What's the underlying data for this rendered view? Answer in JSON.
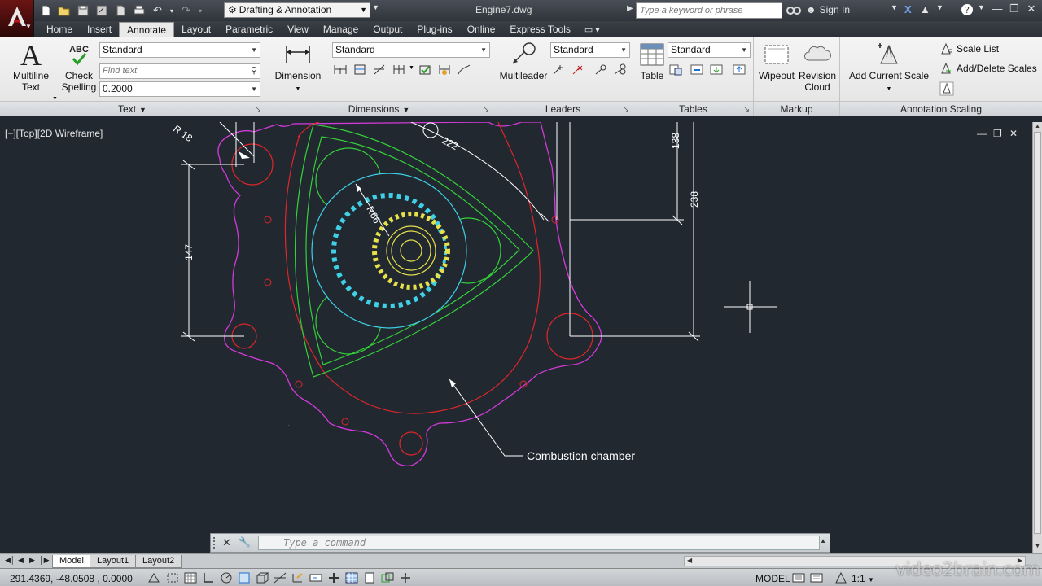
{
  "titlebar": {
    "workspace": "Drafting & Annotation",
    "document": "Engine7.dwg",
    "search_placeholder": "Type a keyword or phrase",
    "sign_in": "Sign In"
  },
  "tabs": [
    "Home",
    "Insert",
    "Annotate",
    "Layout",
    "Parametric",
    "View",
    "Manage",
    "Output",
    "Plug-ins",
    "Online",
    "Express Tools"
  ],
  "active_tab": "Annotate",
  "ribbon": {
    "text_panel": {
      "title": "Text",
      "multiline_line1": "Multiline",
      "multiline_line2": "Text",
      "check_line1": "Check",
      "check_line2": "Spelling",
      "style": "Standard",
      "find_placeholder": "Find text",
      "height": "0.2000"
    },
    "dimensions_panel": {
      "title": "Dimensions",
      "dimension_label": "Dimension",
      "style": "Standard"
    },
    "leaders_panel": {
      "title": "Leaders",
      "multileader_label": "Multileader",
      "style": "Standard"
    },
    "tables_panel": {
      "title": "Tables",
      "table_label": "Table",
      "style": "Standard"
    },
    "markup_panel": {
      "title": "Markup",
      "wipeout_label": "Wipeout",
      "revision_line1": "Revision",
      "revision_line2": "Cloud"
    },
    "annotation_scaling_panel": {
      "title": "Annotation Scaling",
      "add_current_scale": "Add Current Scale",
      "scale_list": "Scale List",
      "add_delete_scales": "Add/Delete Scales"
    }
  },
  "viewport": {
    "label": "[−][Top][2D Wireframe]"
  },
  "drawing": {
    "dim_r18": "R 18",
    "dim_222": "222",
    "dim_138": "138",
    "dim_238": "238",
    "dim_147": "147",
    "dim_r66": "R66",
    "leader_note": "Combustion chamber"
  },
  "command_line": {
    "placeholder": "Type a command"
  },
  "layout_tabs": [
    "Model",
    "Layout1",
    "Layout2"
  ],
  "active_layout": "Model",
  "status": {
    "coordinates": "291.4369, -48.0508 , 0.0000",
    "model": "MODEL",
    "annotation_scale": "1:1"
  },
  "watermark": "video2brain.com",
  "colors": {
    "canvas": "#212830",
    "gasket": "#d23ad8",
    "housing": "#e0262a",
    "rotor": "#35d13a",
    "bearing": "#3fd0e6",
    "gear": "#e6e04a",
    "dimension": "#ffffff"
  }
}
